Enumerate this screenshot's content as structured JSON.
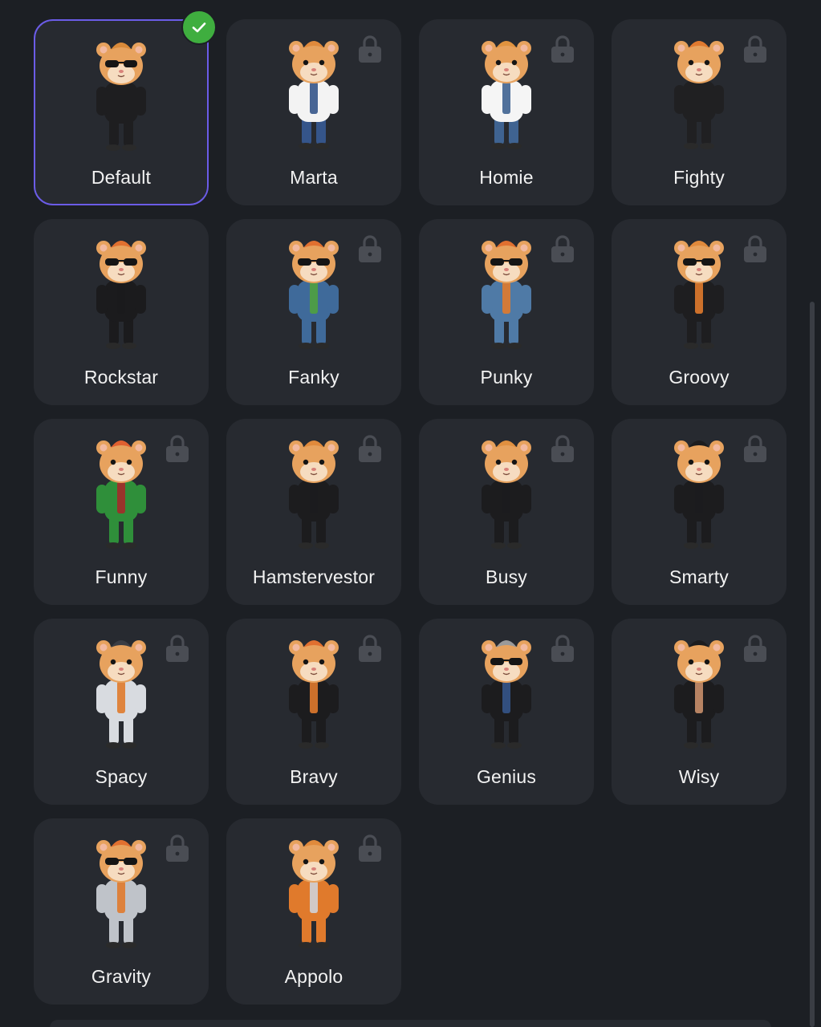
{
  "skins": [
    {
      "name": "Default",
      "selected": true,
      "locked": false,
      "outfit": "#1e1e20",
      "hair": "#d98a3a",
      "accent": "#1e1e20",
      "glasses": true
    },
    {
      "name": "Marta",
      "selected": false,
      "locked": true,
      "outfit": "#f3f3f3",
      "hair": "#e08a3c",
      "accent": "#35558a",
      "glasses": false
    },
    {
      "name": "Homie",
      "selected": false,
      "locked": true,
      "outfit": "#f5f5f5",
      "hair": "#e0933f",
      "accent": "#3f6391",
      "glasses": false
    },
    {
      "name": "Fighty",
      "selected": false,
      "locked": true,
      "outfit": "#202022",
      "hair": "#e07a30",
      "accent": "#202022",
      "glasses": false
    },
    {
      "name": "Rockstar",
      "selected": false,
      "locked": false,
      "outfit": "#1b1b1d",
      "hair": "#e07030",
      "accent": "#1b1b1d",
      "glasses": true
    },
    {
      "name": "Fanky",
      "selected": false,
      "locked": true,
      "outfit": "#3f6a9a",
      "hair": "#e07030",
      "accent": "#4fa13f",
      "glasses": true
    },
    {
      "name": "Punky",
      "selected": false,
      "locked": true,
      "outfit": "#4f7aa6",
      "hair": "#e07030",
      "accent": "#e07a2c",
      "glasses": true
    },
    {
      "name": "Groovy",
      "selected": false,
      "locked": true,
      "outfit": "#1e1e20",
      "hair": "#e08a3c",
      "accent": "#e07a2c",
      "glasses": true
    },
    {
      "name": "Funny",
      "selected": false,
      "locked": true,
      "outfit": "#2f8f3a",
      "hair": "#e06030",
      "accent": "#a52a2a",
      "glasses": false
    },
    {
      "name": "Hamstervestor",
      "selected": false,
      "locked": true,
      "outfit": "#1c1c1e",
      "hair": "#e08a3c",
      "accent": "#1c1c1e",
      "glasses": false
    },
    {
      "name": "Busy",
      "selected": false,
      "locked": true,
      "outfit": "#1c1c1e",
      "hair": "#e09040",
      "accent": "#1c1c1e",
      "glasses": false
    },
    {
      "name": "Smarty",
      "selected": false,
      "locked": true,
      "outfit": "#1c1c1e",
      "hair": "#1c1c1e",
      "accent": "#1c1c1e",
      "glasses": false
    },
    {
      "name": "Spacy",
      "selected": false,
      "locked": true,
      "outfit": "#d8dbe0",
      "hair": "#3a3d44",
      "accent": "#e07a2c",
      "glasses": false
    },
    {
      "name": "Bravy",
      "selected": false,
      "locked": true,
      "outfit": "#1c1c1e",
      "hair": "#e07030",
      "accent": "#e07a2c",
      "glasses": false
    },
    {
      "name": "Genius",
      "selected": false,
      "locked": true,
      "outfit": "#1c1c1e",
      "hair": "#9a9a9a",
      "accent": "#35558a",
      "glasses": true
    },
    {
      "name": "Wisy",
      "selected": false,
      "locked": true,
      "outfit": "#1c1c1e",
      "hair": "#1c1c1e",
      "accent": "#c98f6a",
      "glasses": false
    },
    {
      "name": "Gravity",
      "selected": false,
      "locked": true,
      "outfit": "#bfc3c9",
      "hair": "#e07030",
      "accent": "#e07a2c",
      "glasses": true
    },
    {
      "name": "Appolo",
      "selected": false,
      "locked": true,
      "outfit": "#e07a2c",
      "hair": "#e08a3c",
      "accent": "#cfd2d8",
      "glasses": false
    }
  ],
  "colors": {
    "background": "#1c1f24",
    "card": "#272a30",
    "selected_border": "#6b5ce7",
    "check_badge": "#3fae3f",
    "lock_icon": "#4a4d54",
    "fur": "#e7a25e",
    "fur_light": "#f6dcc0"
  },
  "icons": {
    "lock": "lock-icon",
    "check": "checkmark-icon"
  }
}
